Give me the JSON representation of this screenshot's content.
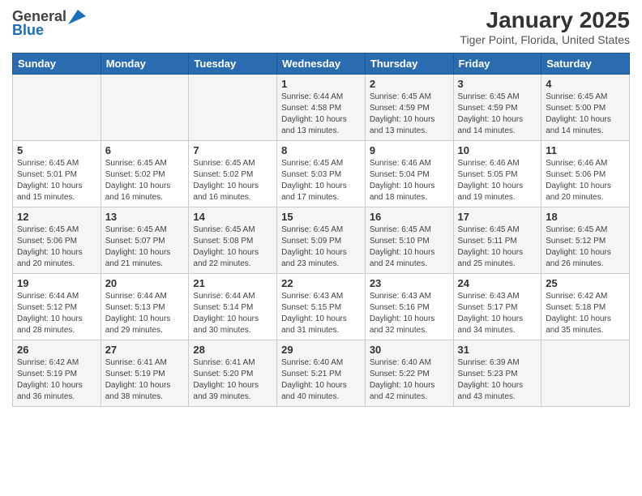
{
  "header": {
    "logo_general": "General",
    "logo_blue": "Blue",
    "title": "January 2025",
    "subtitle": "Tiger Point, Florida, United States"
  },
  "weekdays": [
    "Sunday",
    "Monday",
    "Tuesday",
    "Wednesday",
    "Thursday",
    "Friday",
    "Saturday"
  ],
  "weeks": [
    [
      {
        "day": "",
        "detail": ""
      },
      {
        "day": "",
        "detail": ""
      },
      {
        "day": "",
        "detail": ""
      },
      {
        "day": "1",
        "detail": "Sunrise: 6:44 AM\nSunset: 4:58 PM\nDaylight: 10 hours\nand 13 minutes."
      },
      {
        "day": "2",
        "detail": "Sunrise: 6:45 AM\nSunset: 4:59 PM\nDaylight: 10 hours\nand 13 minutes."
      },
      {
        "day": "3",
        "detail": "Sunrise: 6:45 AM\nSunset: 4:59 PM\nDaylight: 10 hours\nand 14 minutes."
      },
      {
        "day": "4",
        "detail": "Sunrise: 6:45 AM\nSunset: 5:00 PM\nDaylight: 10 hours\nand 14 minutes."
      }
    ],
    [
      {
        "day": "5",
        "detail": "Sunrise: 6:45 AM\nSunset: 5:01 PM\nDaylight: 10 hours\nand 15 minutes."
      },
      {
        "day": "6",
        "detail": "Sunrise: 6:45 AM\nSunset: 5:02 PM\nDaylight: 10 hours\nand 16 minutes."
      },
      {
        "day": "7",
        "detail": "Sunrise: 6:45 AM\nSunset: 5:02 PM\nDaylight: 10 hours\nand 16 minutes."
      },
      {
        "day": "8",
        "detail": "Sunrise: 6:45 AM\nSunset: 5:03 PM\nDaylight: 10 hours\nand 17 minutes."
      },
      {
        "day": "9",
        "detail": "Sunrise: 6:46 AM\nSunset: 5:04 PM\nDaylight: 10 hours\nand 18 minutes."
      },
      {
        "day": "10",
        "detail": "Sunrise: 6:46 AM\nSunset: 5:05 PM\nDaylight: 10 hours\nand 19 minutes."
      },
      {
        "day": "11",
        "detail": "Sunrise: 6:46 AM\nSunset: 5:06 PM\nDaylight: 10 hours\nand 20 minutes."
      }
    ],
    [
      {
        "day": "12",
        "detail": "Sunrise: 6:45 AM\nSunset: 5:06 PM\nDaylight: 10 hours\nand 20 minutes."
      },
      {
        "day": "13",
        "detail": "Sunrise: 6:45 AM\nSunset: 5:07 PM\nDaylight: 10 hours\nand 21 minutes."
      },
      {
        "day": "14",
        "detail": "Sunrise: 6:45 AM\nSunset: 5:08 PM\nDaylight: 10 hours\nand 22 minutes."
      },
      {
        "day": "15",
        "detail": "Sunrise: 6:45 AM\nSunset: 5:09 PM\nDaylight: 10 hours\nand 23 minutes."
      },
      {
        "day": "16",
        "detail": "Sunrise: 6:45 AM\nSunset: 5:10 PM\nDaylight: 10 hours\nand 24 minutes."
      },
      {
        "day": "17",
        "detail": "Sunrise: 6:45 AM\nSunset: 5:11 PM\nDaylight: 10 hours\nand 25 minutes."
      },
      {
        "day": "18",
        "detail": "Sunrise: 6:45 AM\nSunset: 5:12 PM\nDaylight: 10 hours\nand 26 minutes."
      }
    ],
    [
      {
        "day": "19",
        "detail": "Sunrise: 6:44 AM\nSunset: 5:12 PM\nDaylight: 10 hours\nand 28 minutes."
      },
      {
        "day": "20",
        "detail": "Sunrise: 6:44 AM\nSunset: 5:13 PM\nDaylight: 10 hours\nand 29 minutes."
      },
      {
        "day": "21",
        "detail": "Sunrise: 6:44 AM\nSunset: 5:14 PM\nDaylight: 10 hours\nand 30 minutes."
      },
      {
        "day": "22",
        "detail": "Sunrise: 6:43 AM\nSunset: 5:15 PM\nDaylight: 10 hours\nand 31 minutes."
      },
      {
        "day": "23",
        "detail": "Sunrise: 6:43 AM\nSunset: 5:16 PM\nDaylight: 10 hours\nand 32 minutes."
      },
      {
        "day": "24",
        "detail": "Sunrise: 6:43 AM\nSunset: 5:17 PM\nDaylight: 10 hours\nand 34 minutes."
      },
      {
        "day": "25",
        "detail": "Sunrise: 6:42 AM\nSunset: 5:18 PM\nDaylight: 10 hours\nand 35 minutes."
      }
    ],
    [
      {
        "day": "26",
        "detail": "Sunrise: 6:42 AM\nSunset: 5:19 PM\nDaylight: 10 hours\nand 36 minutes."
      },
      {
        "day": "27",
        "detail": "Sunrise: 6:41 AM\nSunset: 5:19 PM\nDaylight: 10 hours\nand 38 minutes."
      },
      {
        "day": "28",
        "detail": "Sunrise: 6:41 AM\nSunset: 5:20 PM\nDaylight: 10 hours\nand 39 minutes."
      },
      {
        "day": "29",
        "detail": "Sunrise: 6:40 AM\nSunset: 5:21 PM\nDaylight: 10 hours\nand 40 minutes."
      },
      {
        "day": "30",
        "detail": "Sunrise: 6:40 AM\nSunset: 5:22 PM\nDaylight: 10 hours\nand 42 minutes."
      },
      {
        "day": "31",
        "detail": "Sunrise: 6:39 AM\nSunset: 5:23 PM\nDaylight: 10 hours\nand 43 minutes."
      },
      {
        "day": "",
        "detail": ""
      }
    ]
  ]
}
